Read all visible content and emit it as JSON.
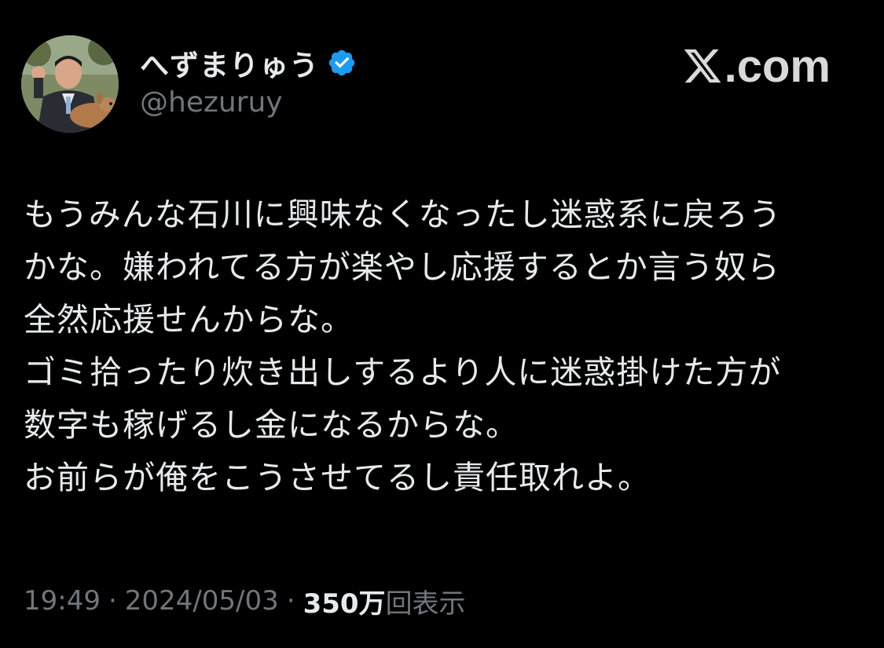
{
  "brand": {
    "name": ".com",
    "logo": "x-logo-icon"
  },
  "author": {
    "display_name": "へずまりゅう",
    "handle": "@hezuruy",
    "verified": true,
    "avatar": "avatar-photo-man-with-deer",
    "verified_color": "#1d9bf0"
  },
  "tweet": {
    "lines": [
      "もうみんな石川に興味なくなったし迷惑系に戻ろう",
      "かな。嫌われてる方が楽やし応援するとか言う奴ら",
      "全然応援せんからな。",
      "ゴミ拾ったり炊き出しするより人に迷惑掛けた方が",
      "数字も稼げるし金になるからな。",
      "お前らが俺をこうさせてるし責任取れよ。"
    ]
  },
  "meta": {
    "time": "19:49",
    "separator": "·",
    "date": "2024/05/03",
    "views_count": "350万",
    "views_label": "回表示"
  },
  "colors": {
    "background": "#000000",
    "text": "#e7e9ea",
    "secondary": "#71767b"
  }
}
